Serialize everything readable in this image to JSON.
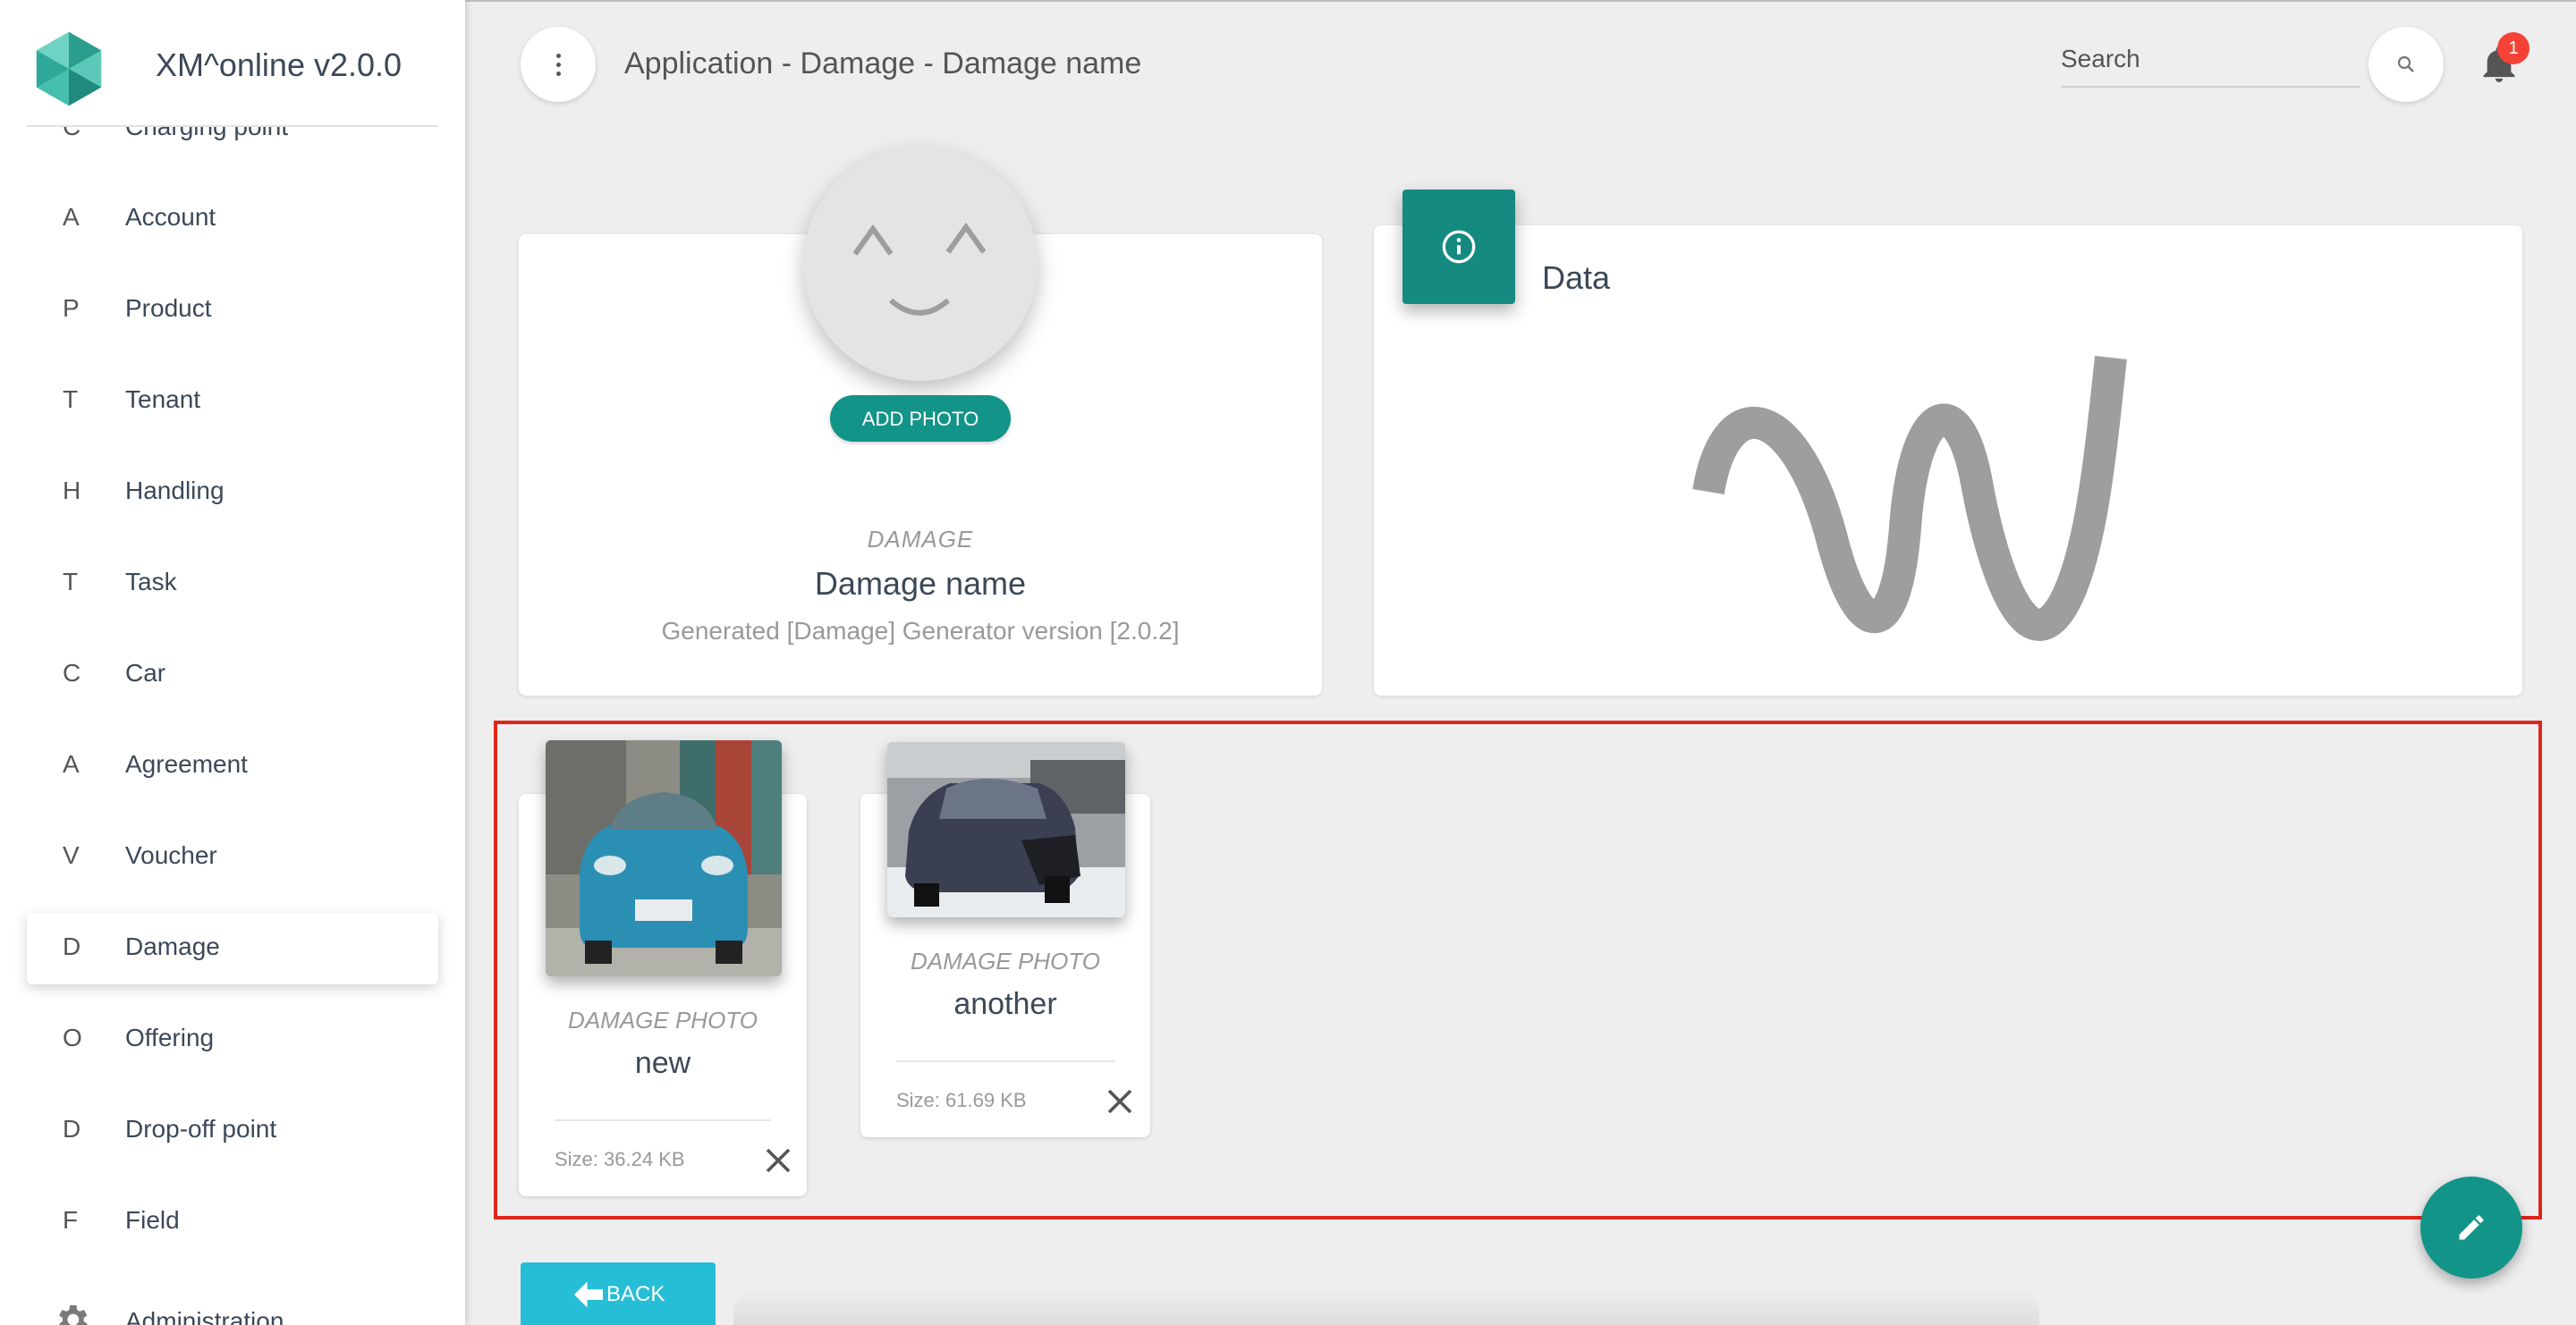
{
  "app": {
    "title": "XM^online v2.0.0"
  },
  "sidebar": {
    "partial_item": {
      "abbr": "C",
      "label": "Charging point"
    },
    "items": [
      {
        "abbr": "A",
        "label": "Account"
      },
      {
        "abbr": "P",
        "label": "Product"
      },
      {
        "abbr": "T",
        "label": "Tenant"
      },
      {
        "abbr": "H",
        "label": "Handling"
      },
      {
        "abbr": "T",
        "label": "Task"
      },
      {
        "abbr": "C",
        "label": "Car"
      },
      {
        "abbr": "A",
        "label": "Agreement"
      },
      {
        "abbr": "V",
        "label": "Voucher"
      },
      {
        "abbr": "D",
        "label": "Damage",
        "active": true
      },
      {
        "abbr": "O",
        "label": "Offering"
      },
      {
        "abbr": "D",
        "label": "Drop-off point"
      },
      {
        "abbr": "F",
        "label": "Field"
      }
    ],
    "administration": {
      "label": "Administration",
      "icon": "gear-icon"
    }
  },
  "header": {
    "breadcrumb": "Application - Damage - Damage name",
    "search": {
      "placeholder": "Search",
      "value": ""
    },
    "notifications": {
      "count": "1"
    }
  },
  "profile": {
    "add_photo_label": "ADD PHOTO",
    "category": "DAMAGE",
    "name": "Damage name",
    "description": "Generated [Damage] Generator version [2.0.2]"
  },
  "data_card": {
    "title": "Data"
  },
  "photos": [
    {
      "category": "DAMAGE PHOTO",
      "name": "new",
      "size": "Size: 36.24 KB"
    },
    {
      "category": "DAMAGE PHOTO",
      "name": "another",
      "size": "Size: 61.69 KB"
    }
  ],
  "back_label": "BACK",
  "colors": {
    "accent": "#139488",
    "back_button": "#26bed6",
    "highlight_frame": "#e0261b",
    "badge": "#f44336"
  }
}
